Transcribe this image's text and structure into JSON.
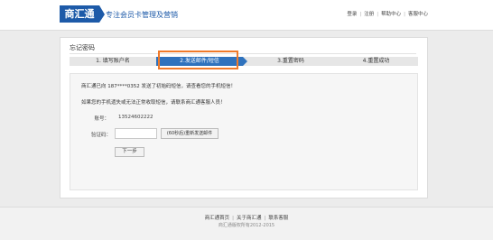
{
  "header": {
    "logo_text": "商汇通",
    "slogan": "专注会员卡管理及营销",
    "links": [
      "登录",
      "注册",
      "帮助中心",
      "客服中心"
    ]
  },
  "card": {
    "title": "忘记密码",
    "steps": [
      {
        "label": "1. 填写账户名",
        "active": false
      },
      {
        "label": "2.发送邮件/短信",
        "active": true
      },
      {
        "label": "3.重置密码",
        "active": false
      },
      {
        "label": "4.重置成功",
        "active": false
      }
    ],
    "message_prefix": "商汇通已向 ",
    "masked_phone": "187****0352",
    "message_suffix": " 发送了初始码短信，请查看您的手机短信！",
    "lost_phone_note": "如果您的手机遗失或无法正常收取短信，请联系商汇通客服人员！",
    "account_label": "账号：",
    "account_value": "13524602222",
    "code_label": "验证码：",
    "code_value": "",
    "resend_label": "(60秒后)重新发送邮件",
    "next_label": "下一步"
  },
  "footer": {
    "links": [
      "商汇通首页",
      "关于商汇通",
      "联系客服"
    ],
    "copyright": "商汇通版权所有2012-2015"
  },
  "colors": {
    "brand": "#1d5aa8",
    "active_step": "#2f72bd",
    "highlight_box": "#f07a2a"
  }
}
